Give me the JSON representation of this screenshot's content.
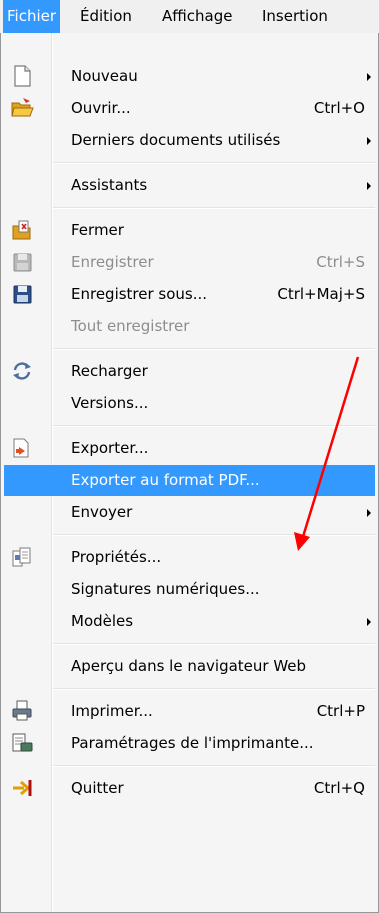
{
  "menubar": {
    "items": [
      {
        "label": "Fichier"
      },
      {
        "label": "Édition"
      },
      {
        "label": "Affichage"
      },
      {
        "label": "Insertion"
      }
    ]
  },
  "menu": {
    "items": [
      {
        "label": "Nouveau",
        "icon": "new-document-icon"
      },
      {
        "label": "Ouvrir...",
        "shortcut": "Ctrl+O",
        "icon": "open-folder-icon"
      },
      {
        "label": "Derniers documents utilisés"
      },
      {
        "label": "Assistants"
      },
      {
        "label": "Fermer",
        "icon": "close-document-icon"
      },
      {
        "label": "Enregistrer",
        "shortcut": "Ctrl+S",
        "icon": "save-icon",
        "state": "disabled"
      },
      {
        "label": "Enregistrer sous...",
        "shortcut": "Ctrl+Maj+S",
        "icon": "save-as-icon"
      },
      {
        "label": "Tout enregistrer",
        "state": "disabled"
      },
      {
        "label": "Recharger",
        "icon": "reload-icon"
      },
      {
        "label": "Versions..."
      },
      {
        "label": "Exporter...",
        "icon": "export-icon"
      },
      {
        "label": "Exporter au format PDF...",
        "state": "highlighted"
      },
      {
        "label": "Envoyer"
      },
      {
        "label": "Propriétés...",
        "icon": "properties-icon"
      },
      {
        "label": "Signatures numériques..."
      },
      {
        "label": "Modèles"
      },
      {
        "label": "Aperçu dans le navigateur Web"
      },
      {
        "label": "Imprimer...",
        "shortcut": "Ctrl+P",
        "icon": "printer-icon"
      },
      {
        "label": "Paramétrages de l'imprimante...",
        "icon": "printer-settings-icon"
      },
      {
        "label": "Quitter",
        "shortcut": "Ctrl+Q",
        "icon": "exit-icon"
      }
    ]
  },
  "colors": {
    "highlight": "#3399ff",
    "annotation_arrow": "#ff0000",
    "disabled_text": "#8d8d8d"
  }
}
